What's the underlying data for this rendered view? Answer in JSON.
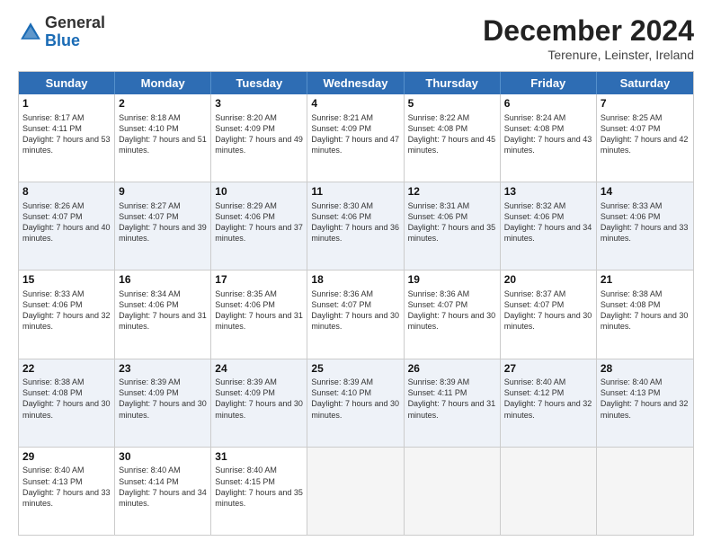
{
  "header": {
    "logo_general": "General",
    "logo_blue": "Blue",
    "month_title": "December 2024",
    "location": "Terenure, Leinster, Ireland"
  },
  "days_of_week": [
    "Sunday",
    "Monday",
    "Tuesday",
    "Wednesday",
    "Thursday",
    "Friday",
    "Saturday"
  ],
  "weeks": [
    [
      {
        "day": "1",
        "sunrise": "Sunrise: 8:17 AM",
        "sunset": "Sunset: 4:11 PM",
        "daylight": "Daylight: 7 hours and 53 minutes.",
        "empty": false
      },
      {
        "day": "2",
        "sunrise": "Sunrise: 8:18 AM",
        "sunset": "Sunset: 4:10 PM",
        "daylight": "Daylight: 7 hours and 51 minutes.",
        "empty": false
      },
      {
        "day": "3",
        "sunrise": "Sunrise: 8:20 AM",
        "sunset": "Sunset: 4:09 PM",
        "daylight": "Daylight: 7 hours and 49 minutes.",
        "empty": false
      },
      {
        "day": "4",
        "sunrise": "Sunrise: 8:21 AM",
        "sunset": "Sunset: 4:09 PM",
        "daylight": "Daylight: 7 hours and 47 minutes.",
        "empty": false
      },
      {
        "day": "5",
        "sunrise": "Sunrise: 8:22 AM",
        "sunset": "Sunset: 4:08 PM",
        "daylight": "Daylight: 7 hours and 45 minutes.",
        "empty": false
      },
      {
        "day": "6",
        "sunrise": "Sunrise: 8:24 AM",
        "sunset": "Sunset: 4:08 PM",
        "daylight": "Daylight: 7 hours and 43 minutes.",
        "empty": false
      },
      {
        "day": "7",
        "sunrise": "Sunrise: 8:25 AM",
        "sunset": "Sunset: 4:07 PM",
        "daylight": "Daylight: 7 hours and 42 minutes.",
        "empty": false
      }
    ],
    [
      {
        "day": "8",
        "sunrise": "Sunrise: 8:26 AM",
        "sunset": "Sunset: 4:07 PM",
        "daylight": "Daylight: 7 hours and 40 minutes.",
        "empty": false
      },
      {
        "day": "9",
        "sunrise": "Sunrise: 8:27 AM",
        "sunset": "Sunset: 4:07 PM",
        "daylight": "Daylight: 7 hours and 39 minutes.",
        "empty": false
      },
      {
        "day": "10",
        "sunrise": "Sunrise: 8:29 AM",
        "sunset": "Sunset: 4:06 PM",
        "daylight": "Daylight: 7 hours and 37 minutes.",
        "empty": false
      },
      {
        "day": "11",
        "sunrise": "Sunrise: 8:30 AM",
        "sunset": "Sunset: 4:06 PM",
        "daylight": "Daylight: 7 hours and 36 minutes.",
        "empty": false
      },
      {
        "day": "12",
        "sunrise": "Sunrise: 8:31 AM",
        "sunset": "Sunset: 4:06 PM",
        "daylight": "Daylight: 7 hours and 35 minutes.",
        "empty": false
      },
      {
        "day": "13",
        "sunrise": "Sunrise: 8:32 AM",
        "sunset": "Sunset: 4:06 PM",
        "daylight": "Daylight: 7 hours and 34 minutes.",
        "empty": false
      },
      {
        "day": "14",
        "sunrise": "Sunrise: 8:33 AM",
        "sunset": "Sunset: 4:06 PM",
        "daylight": "Daylight: 7 hours and 33 minutes.",
        "empty": false
      }
    ],
    [
      {
        "day": "15",
        "sunrise": "Sunrise: 8:33 AM",
        "sunset": "Sunset: 4:06 PM",
        "daylight": "Daylight: 7 hours and 32 minutes.",
        "empty": false
      },
      {
        "day": "16",
        "sunrise": "Sunrise: 8:34 AM",
        "sunset": "Sunset: 4:06 PM",
        "daylight": "Daylight: 7 hours and 31 minutes.",
        "empty": false
      },
      {
        "day": "17",
        "sunrise": "Sunrise: 8:35 AM",
        "sunset": "Sunset: 4:06 PM",
        "daylight": "Daylight: 7 hours and 31 minutes.",
        "empty": false
      },
      {
        "day": "18",
        "sunrise": "Sunrise: 8:36 AM",
        "sunset": "Sunset: 4:07 PM",
        "daylight": "Daylight: 7 hours and 30 minutes.",
        "empty": false
      },
      {
        "day": "19",
        "sunrise": "Sunrise: 8:36 AM",
        "sunset": "Sunset: 4:07 PM",
        "daylight": "Daylight: 7 hours and 30 minutes.",
        "empty": false
      },
      {
        "day": "20",
        "sunrise": "Sunrise: 8:37 AM",
        "sunset": "Sunset: 4:07 PM",
        "daylight": "Daylight: 7 hours and 30 minutes.",
        "empty": false
      },
      {
        "day": "21",
        "sunrise": "Sunrise: 8:38 AM",
        "sunset": "Sunset: 4:08 PM",
        "daylight": "Daylight: 7 hours and 30 minutes.",
        "empty": false
      }
    ],
    [
      {
        "day": "22",
        "sunrise": "Sunrise: 8:38 AM",
        "sunset": "Sunset: 4:08 PM",
        "daylight": "Daylight: 7 hours and 30 minutes.",
        "empty": false
      },
      {
        "day": "23",
        "sunrise": "Sunrise: 8:39 AM",
        "sunset": "Sunset: 4:09 PM",
        "daylight": "Daylight: 7 hours and 30 minutes.",
        "empty": false
      },
      {
        "day": "24",
        "sunrise": "Sunrise: 8:39 AM",
        "sunset": "Sunset: 4:09 PM",
        "daylight": "Daylight: 7 hours and 30 minutes.",
        "empty": false
      },
      {
        "day": "25",
        "sunrise": "Sunrise: 8:39 AM",
        "sunset": "Sunset: 4:10 PM",
        "daylight": "Daylight: 7 hours and 30 minutes.",
        "empty": false
      },
      {
        "day": "26",
        "sunrise": "Sunrise: 8:39 AM",
        "sunset": "Sunset: 4:11 PM",
        "daylight": "Daylight: 7 hours and 31 minutes.",
        "empty": false
      },
      {
        "day": "27",
        "sunrise": "Sunrise: 8:40 AM",
        "sunset": "Sunset: 4:12 PM",
        "daylight": "Daylight: 7 hours and 32 minutes.",
        "empty": false
      },
      {
        "day": "28",
        "sunrise": "Sunrise: 8:40 AM",
        "sunset": "Sunset: 4:13 PM",
        "daylight": "Daylight: 7 hours and 32 minutes.",
        "empty": false
      }
    ],
    [
      {
        "day": "29",
        "sunrise": "Sunrise: 8:40 AM",
        "sunset": "Sunset: 4:13 PM",
        "daylight": "Daylight: 7 hours and 33 minutes.",
        "empty": false
      },
      {
        "day": "30",
        "sunrise": "Sunrise: 8:40 AM",
        "sunset": "Sunset: 4:14 PM",
        "daylight": "Daylight: 7 hours and 34 minutes.",
        "empty": false
      },
      {
        "day": "31",
        "sunrise": "Sunrise: 8:40 AM",
        "sunset": "Sunset: 4:15 PM",
        "daylight": "Daylight: 7 hours and 35 minutes.",
        "empty": false
      },
      {
        "day": "",
        "sunrise": "",
        "sunset": "",
        "daylight": "",
        "empty": true
      },
      {
        "day": "",
        "sunrise": "",
        "sunset": "",
        "daylight": "",
        "empty": true
      },
      {
        "day": "",
        "sunrise": "",
        "sunset": "",
        "daylight": "",
        "empty": true
      },
      {
        "day": "",
        "sunrise": "",
        "sunset": "",
        "daylight": "",
        "empty": true
      }
    ]
  ]
}
